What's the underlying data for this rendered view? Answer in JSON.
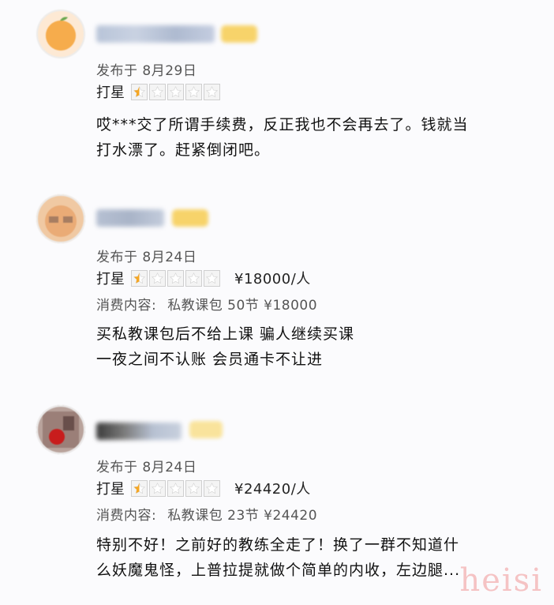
{
  "reviews": [
    {
      "published": "发布于 8月29日",
      "rating_label": "打星",
      "stars_filled": 0.5,
      "stars_total": 5,
      "price": "",
      "consumption": null,
      "body": [
        "哎***交了所谓手续费，反正我也不会再去了。钱就当",
        "打水漂了。赶紧倒闭吧。"
      ]
    },
    {
      "published": "发布于 8月24日",
      "rating_label": "打星",
      "stars_filled": 0.5,
      "stars_total": 5,
      "price": "¥18000/人",
      "consumption": {
        "label": "消费内容:",
        "item": "私教课包 50节 ¥18000"
      },
      "body": [
        "买私教课包后不给上课 骗人继续买课",
        "一夜之间不认账 会员通卡不让进"
      ]
    },
    {
      "published": "发布于 8月24日",
      "rating_label": "打星",
      "stars_filled": 0.5,
      "stars_total": 5,
      "price": "¥24420/人",
      "consumption": {
        "label": "消费内容:",
        "item": "私教课包 23节 ¥24420"
      },
      "body": [
        "特别不好！之前好的教练全走了！换了一群不知道什",
        "么妖魔鬼怪，上普拉提就做个简单的内收，左边腿..."
      ]
    }
  ],
  "watermark": "heisi",
  "colors": {
    "star_fill": "#f5a623",
    "star_empty": "#ffffff",
    "badge": "#f7d36a",
    "watermark": "#f09696"
  }
}
